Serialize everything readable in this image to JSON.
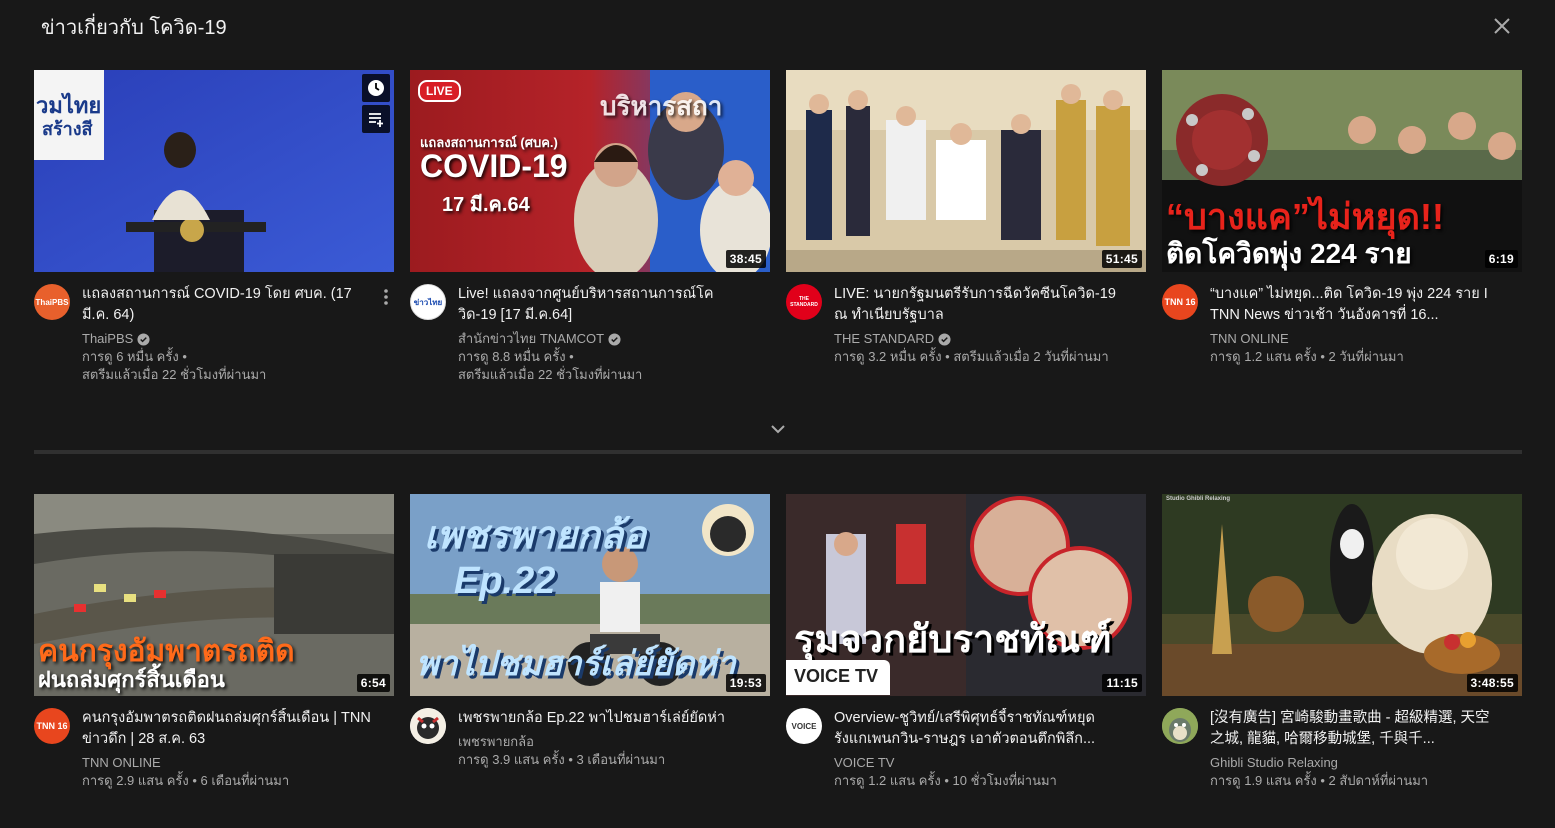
{
  "shelf": {
    "title": "ข่าวเกี่ยวกับ โควิด-19",
    "close_icon": "close-icon",
    "expand_icon": "chevron-down-icon"
  },
  "videos": [
    {
      "title": "แถลงสถานการณ์ COVID-19 โดย ศบค. (17 มี.ค. 64)",
      "channel": "ThaiPBS",
      "verified": true,
      "views": "การดู 6 หมื่น ครั้ง",
      "age": "สตรีมแล้วเมื่อ 22 ชั่วโมงที่ผ่านมา",
      "duration": "",
      "avatar_text": "ThaiPBS",
      "avatar_color": "#e8602c",
      "thumb_text": [
        "วมไทย",
        "สร้างสี"
      ]
    },
    {
      "title": "Live! แถลงจากศูนย์บริหารสถานการณ์โควิด-19 [17 มี.ค.64]",
      "channel": "สำนักข่าวไทย TNAMCOT",
      "verified": true,
      "views": "การดู 8.8 หมื่น ครั้ง",
      "age": "สตรีมแล้วเมื่อ 22 ชั่วโมงที่ผ่านมา",
      "duration": "38:45",
      "avatar_text": "ข่าวไทย",
      "avatar_color": "#ffffff",
      "thumb_text": [
        "LIVE",
        "แถลงสถานการณ์ (ศบค.)",
        "COVID-19",
        "17 มี.ค.64",
        "บริหารสถา"
      ]
    },
    {
      "title": "LIVE: นายกรัฐมนตรีรับการฉีดวัคซีนโควิด-19 ณ ทำเนียบรัฐบาล",
      "channel": "THE STANDARD",
      "verified": true,
      "views": "การดู 3.2 หมื่น ครั้ง",
      "age": "สตรีมแล้วเมื่อ 2 วันที่ผ่านมา",
      "duration": "51:45",
      "avatar_text": "THE STANDARD",
      "avatar_color": "#e1001a",
      "thumb_text": []
    },
    {
      "title": "“บางแค” ไม่หยุด...ติด โควิด-19 พุ่ง 224 ราย I TNN News ข่าวเช้า วันอังคารที่ 16...",
      "channel": "TNN ONLINE",
      "verified": false,
      "views": "การดู 1.2 แสน ครั้ง",
      "age": "2 วันที่ผ่านมา",
      "duration": "6:19",
      "avatar_text": "TNN 16",
      "avatar_color": "#e8461e",
      "thumb_text": [
        "“บางแค”ไม่หยุด!!",
        "ติดโควิดพุ่ง 224 ราย"
      ]
    },
    {
      "title": "คนกรุงอัมพาตรถติดฝนถล่มศุกร์สิ้นเดือน | TNN ข่าวดึก | 28 ส.ค. 63",
      "channel": "TNN ONLINE",
      "verified": false,
      "views": "การดู 2.9 แสน ครั้ง",
      "age": "6 เดือนที่ผ่านมา",
      "duration": "6:54",
      "avatar_text": "TNN 16",
      "avatar_color": "#e8461e",
      "thumb_text": [
        "คนกรุงอัมพาตรถติด",
        "ฝนถล่มศุกร์สิ้นเดือน"
      ]
    },
    {
      "title": "เพชรพายกล้อ Ep.22 พาไปชมฮาร์เล่ย์ยัดห่า",
      "channel": "เพชรพายกล้อ",
      "verified": false,
      "views": "การดู 3.9 แสน ครั้ง",
      "age": "3 เดือนที่ผ่านมา",
      "duration": "19:53",
      "avatar_text": "",
      "avatar_color": "#ffffff",
      "thumb_text": [
        "เพชรพายกล้อ",
        "Ep.22",
        "พาไปชมฮาร์เล่ย์ยัดห่า"
      ]
    },
    {
      "title": "Overview-ชูวิทย์/เสรีพิศุทธ์จี้ราชทัณฑ์หยุดรังแกเพนกวิน-ราษฎร เอาตัวตอนตึกพิลึก...",
      "channel": "VOICE TV",
      "verified": false,
      "views": "การดู 1.2 แสน ครั้ง",
      "age": "10 ชั่วโมงที่ผ่านมา",
      "duration": "11:15",
      "avatar_text": "VOICE",
      "avatar_color": "#ffffff",
      "thumb_text": [
        "รุมจวกยับราชทัณฑ์",
        "VOICE TV"
      ]
    },
    {
      "title": "[沒有廣告] 宮崎駿動畫歌曲 - 超級精選, 天空之城, 龍貓, 哈爾移動城堡, 千與千...",
      "channel": "Ghibli Studio Relaxing",
      "verified": false,
      "views": "การดู 1.9 แสน ครั้ง",
      "age": "2 สัปดาห์ที่ผ่านมา",
      "duration": "3:48:55",
      "avatar_text": "",
      "avatar_color": "#8fa85a",
      "thumb_text": [
        "Studio Ghibli Relaxing"
      ]
    }
  ],
  "hover_actions": {
    "watch_later_icon": "clock-icon",
    "add_to_queue_icon": "add-queue-icon",
    "more_icon": "more-vert-icon"
  }
}
